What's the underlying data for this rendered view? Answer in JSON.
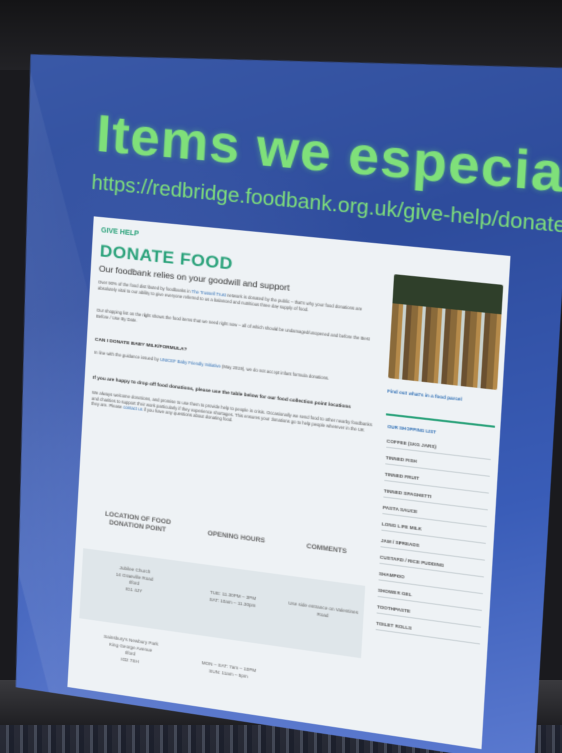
{
  "slide": {
    "heading": "Items we especially need:",
    "url": "https://redbridge.foodbank.org.uk/give-help/donate-food/"
  },
  "webpage": {
    "breadcrumb": "GIVE HELP",
    "title": "DONATE FOOD",
    "subtitle": "Our foodbank relies on your goodwill and support",
    "para1_before": "Over 90% of the food distributed by foodbanks in ",
    "para1_link": "The Trussell Trust",
    "para1_after": " network is donated by the public – that's why your food donations are absolutely vital to our ability to give everyone referred to us a balanced and nutritious three day supply of food.",
    "para2": "Our shopping list on the right shows the food items that we need right now – all of which should be undamaged/unopened and before the Best Before / Use By Date.",
    "q1": "CAN I DONATE BABY MILK/FORMULA?",
    "para3_before": "In line with the guidance issued by ",
    "para3_link": "UNICEF Baby Friendly Initiative",
    "para3_after": " (May 2019), we do not accept infant formula donations.",
    "q2": "If you are happy to drop off food donations, please use the table below for our food collection point locations",
    "para4_before": "We always welcome donations, and promise to use them to provide help to people in crisis. Occasionally we send food to other nearby foodbanks and charities to support their work particularly if they experience shortages. This ensures your donations go to help people wherever in the UK they are. Please ",
    "para4_link": "contact us",
    "para4_after": " if you have any questions about donating food.",
    "table": {
      "headers": [
        "LOCATION OF FOOD DONATION POINT",
        "OPENING HOURS",
        "COMMENTS"
      ],
      "rows": [
        {
          "location": [
            "Jubilee Church",
            "14 Granville Road",
            "Ilford",
            "IG1 4JY"
          ],
          "hours": [
            "TUE: 11.30PM – 3PM",
            "SAT: 10am – 11.30pm"
          ],
          "comments": [
            "Use side entrance on Valentines",
            "Road"
          ]
        },
        {
          "location": [
            "Sainsbury's Newbury Park",
            "King George Avenue",
            "Ilford",
            "IG2 7SH"
          ],
          "hours": [
            "MON – SAT: 7am – 10PM",
            "SUN: 11am – 5pm"
          ],
          "comments": []
        }
      ]
    },
    "sidebar": {
      "photo_link": "Find out what's in a food parcel",
      "list_heading": "OUR SHOPPING LIST",
      "items": [
        "COFFEE (1KG JARS)",
        "TINNED FISH",
        "TINNED FRUIT",
        "TINNED SPAGHETTI",
        "PASTA SAUCE",
        "LONG LIFE MILK",
        "JAM / SPREADS",
        "CUSTARD / RICE PUDDING",
        "SHAMPOO",
        "SHOWER GEL",
        "TOOTHPASTE",
        "TOILET ROLLS"
      ]
    }
  },
  "colors": {
    "heading_green": "#7fe07a",
    "slide_blue": "#3b5aa8",
    "page_green": "#2aa27a",
    "link_blue": "#2f6fb5"
  }
}
